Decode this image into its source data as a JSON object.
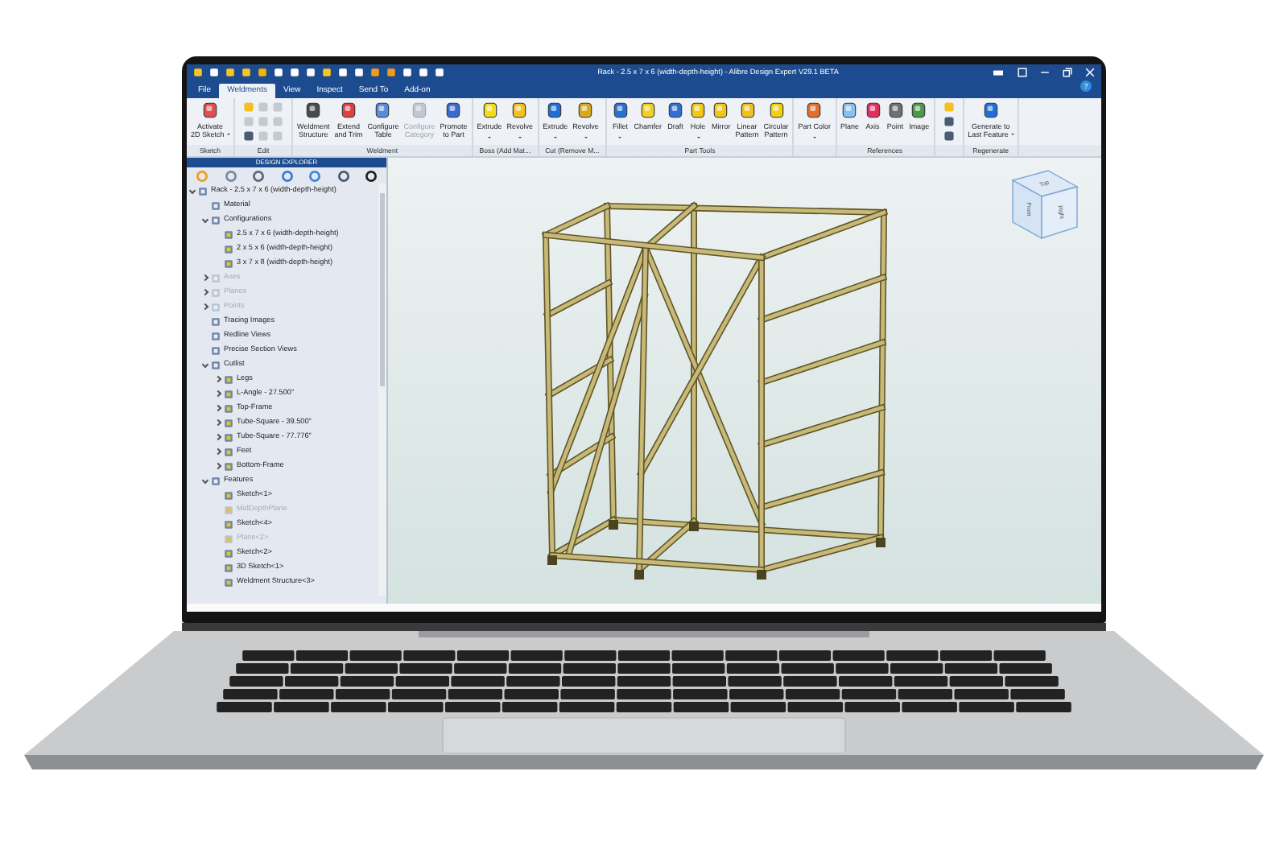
{
  "window": {
    "title": "Rack - 2.5 x 7 x 6 (width-depth-height) - Alibre Design Expert V29.1 BETA"
  },
  "tabs": [
    {
      "label": "File",
      "selected": false
    },
    {
      "label": "Weldments",
      "selected": true
    },
    {
      "label": "View",
      "selected": false
    },
    {
      "label": "Inspect",
      "selected": false
    },
    {
      "label": "Send To",
      "selected": false
    },
    {
      "label": "Add-on",
      "selected": false
    }
  ],
  "help_button": "?",
  "ribbon": {
    "groups": [
      {
        "kind": "large",
        "label": "Sketch",
        "tools": [
          {
            "lines": [
              "Activate",
              "2D Sketch"
            ],
            "dropdown": true,
            "disabled": false
          }
        ]
      },
      {
        "kind": "small",
        "label": "Edit",
        "tools": [
          {
            "disabled": false
          },
          {
            "disabled": true
          },
          {
            "disabled": false
          },
          {
            "disabled": true
          },
          {
            "disabled": true
          },
          {
            "disabled": true
          },
          {
            "disabled": true
          },
          {
            "disabled": true
          },
          {
            "disabled": true
          }
        ]
      },
      {
        "kind": "large",
        "label": "Weldment",
        "tools": [
          {
            "lines": [
              "Weldment",
              "Structure"
            ],
            "dropdown": false,
            "disabled": false
          },
          {
            "lines": [
              "Extend",
              "and Trim"
            ],
            "dropdown": false,
            "disabled": false
          },
          {
            "lines": [
              "Configure",
              "Table"
            ],
            "dropdown": false,
            "disabled": false
          },
          {
            "lines": [
              "Configure",
              "Category"
            ],
            "dropdown": false,
            "disabled": true
          },
          {
            "lines": [
              "Promote",
              "to Part"
            ],
            "dropdown": false,
            "disabled": false
          }
        ]
      },
      {
        "kind": "large",
        "label": "Boss (Add Mat...",
        "tools": [
          {
            "lines": [
              "Extrude"
            ],
            "dropdown": true,
            "disabled": false
          },
          {
            "lines": [
              "Revolve"
            ],
            "dropdown": true,
            "disabled": false
          }
        ]
      },
      {
        "kind": "large",
        "label": "Cut (Remove M...",
        "tools": [
          {
            "lines": [
              "Extrude"
            ],
            "dropdown": true,
            "disabled": false
          },
          {
            "lines": [
              "Revolve"
            ],
            "dropdown": true,
            "disabled": false
          }
        ]
      },
      {
        "kind": "large",
        "label": "Part Tools",
        "tools": [
          {
            "lines": [
              "Fillet"
            ],
            "dropdown": true,
            "disabled": false
          },
          {
            "lines": [
              "Chamfer"
            ],
            "dropdown": false,
            "disabled": false
          },
          {
            "lines": [
              "Draft"
            ],
            "dropdown": false,
            "disabled": false
          },
          {
            "lines": [
              "Hole"
            ],
            "dropdown": true,
            "disabled": false
          },
          {
            "lines": [
              "Mirror"
            ],
            "dropdown": false,
            "disabled": false
          },
          {
            "lines": [
              "Linear",
              "Pattern"
            ],
            "dropdown": false,
            "disabled": false
          },
          {
            "lines": [
              "Circular",
              "Pattern"
            ],
            "dropdown": false,
            "disabled": false
          }
        ]
      },
      {
        "kind": "large",
        "tools": [
          {
            "lines": [
              "Part Color"
            ],
            "dropdown": true,
            "disabled": false
          }
        ]
      },
      {
        "kind": "large",
        "label": "References",
        "tools": [
          {
            "lines": [
              "Plane"
            ],
            "dropdown": false,
            "disabled": false
          },
          {
            "lines": [
              "Axis"
            ],
            "dropdown": false,
            "disabled": false
          },
          {
            "lines": [
              "Point"
            ],
            "dropdown": false,
            "disabled": false
          },
          {
            "lines": [
              "Image"
            ],
            "dropdown": false,
            "disabled": false
          }
        ]
      },
      {
        "kind": "small",
        "tools": [
          {
            "disabled": false
          },
          {
            "disabled": false
          },
          {
            "disabled": false
          }
        ]
      },
      {
        "kind": "large",
        "label": "Regenerate",
        "tools": [
          {
            "lines": [
              "Generate to",
              "Last Feature"
            ],
            "dropdown": true,
            "disabled": false
          }
        ]
      }
    ]
  },
  "explorer": {
    "title": "DESIGN EXPLORER",
    "tree": [
      {
        "label": "Rack - 2.5 x 7 x 6 (width-depth-height)",
        "expanded": true,
        "disabled": false,
        "children": [
          {
            "label": "Material",
            "disabled": false
          },
          {
            "label": "Configurations",
            "expanded": true,
            "disabled": false,
            "children": [
              {
                "label": "2.5 x 7 x 6 (width-depth-height)",
                "disabled": false
              },
              {
                "label": "2 x 5 x 6 (width-depth-height)",
                "disabled": false
              },
              {
                "label": "3 x 7 x 8 (width-depth-height)",
                "disabled": false
              }
            ]
          },
          {
            "label": "Axes",
            "expanded": false,
            "disabled": true
          },
          {
            "label": "Planes",
            "expanded": false,
            "disabled": true
          },
          {
            "label": "Points",
            "expanded": false,
            "disabled": true
          },
          {
            "label": "Tracing Images",
            "disabled": false
          },
          {
            "label": "Redline Views",
            "disabled": false
          },
          {
            "label": "Precise Section Views",
            "disabled": false
          },
          {
            "label": "Cutlist",
            "expanded": true,
            "disabled": false,
            "children": [
              {
                "label": "Legs",
                "expanded": false,
                "disabled": false
              },
              {
                "label": "L-Angle - 27.500\"",
                "expanded": false,
                "disabled": false
              },
              {
                "label": "Top-Frame",
                "expanded": false,
                "disabled": false
              },
              {
                "label": "Tube-Square - 39.500\"",
                "expanded": false,
                "disabled": false
              },
              {
                "label": "Tube-Square - 77.776\"",
                "expanded": false,
                "disabled": false
              },
              {
                "label": "Feet",
                "expanded": false,
                "disabled": false
              },
              {
                "label": "Bottom-Frame",
                "expanded": false,
                "disabled": false
              }
            ]
          },
          {
            "label": "Features",
            "expanded": true,
            "disabled": false,
            "children": [
              {
                "label": "Sketch<1>",
                "disabled": false
              },
              {
                "label": "MidDepthPlane",
                "disabled": true
              },
              {
                "label": "Sketch<4>",
                "disabled": false
              },
              {
                "label": "Plane<2>",
                "disabled": true
              },
              {
                "label": "Sketch<2>",
                "disabled": false
              },
              {
                "label": "3D Sketch<1>",
                "disabled": false
              },
              {
                "label": "Weldment Structure<3>",
                "disabled": false
              }
            ]
          }
        ]
      }
    ]
  },
  "view_cube": {
    "faces": [
      "Top",
      "Front",
      "Right"
    ]
  }
}
